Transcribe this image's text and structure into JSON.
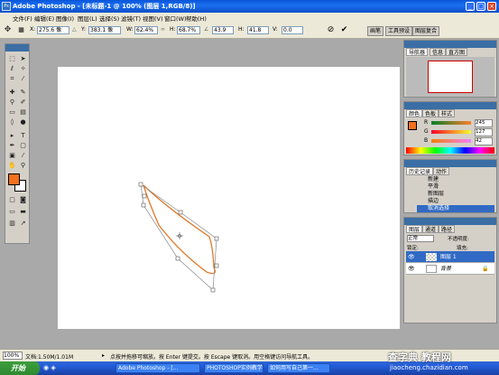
{
  "window": {
    "title": "Adobe Photoshop - [未标题-1 @ 100% (图层 1,RGB/8)]",
    "logo": "Ps",
    "controls": [
      "_",
      "□",
      "×"
    ]
  },
  "menu": {
    "items": [
      "文件(F)",
      "编辑(E)",
      "图像(I)",
      "图层(L)",
      "选择(S)",
      "滤镜(T)",
      "视图(V)",
      "窗口(W)",
      "帮助(H)"
    ]
  },
  "options": {
    "x_label": "X:",
    "x_value": "275.6 像",
    "y_label": "Y:",
    "y_value": "383.1 像",
    "w_label": "W:",
    "w_value": "62.4%",
    "h_label": "H:",
    "h_value": "68.7%",
    "angle_value": "43.9",
    "hskew_label": "H:",
    "hskew_value": "41.8",
    "vskew_label": "V:",
    "vskew_value": "0.0",
    "cancel_icon": "cancel-icon",
    "commit_icon": "commit-icon"
  },
  "dock": {
    "tabs": [
      "画笔",
      "工具预设",
      "图层复合"
    ]
  },
  "navigator": {
    "tabs": [
      "导航器",
      "信息",
      "直方图"
    ]
  },
  "color": {
    "tabs": [
      "颜色",
      "色板",
      "样式"
    ],
    "channels": [
      {
        "label": "R",
        "value": "245"
      },
      {
        "label": "G",
        "value": "127"
      },
      {
        "label": "B",
        "value": "42"
      }
    ],
    "foreground": "#f5701e",
    "background": "#ffffff"
  },
  "history": {
    "tabs": [
      "历史记录",
      "动作"
    ],
    "items": [
      "新建",
      "平滑",
      "新图层",
      "描边",
      "取消选择"
    ],
    "selected_index": 4
  },
  "layers": {
    "tabs": [
      "图层",
      "通道",
      "路径"
    ],
    "blend_mode": "正常",
    "opacity_label": "不透明度:",
    "lock_label": "锁定:",
    "fill_label": "填充:",
    "rows": [
      {
        "name": "图层 1",
        "selected": true
      },
      {
        "name": "背景",
        "selected": false
      }
    ]
  },
  "status": {
    "zoom": "100%",
    "doc_info": "文档:1.50M/1.01M",
    "hint": "点按并拖移可缩放。按 Enter 键提交。按 Escape 键取消。用空格键访问导航工具。"
  },
  "taskbar": {
    "start": "开始",
    "tasks": [
      "Adobe Photoshop - [...",
      "PHOTOSHOP实例教学",
      "如何用写自己第一..."
    ],
    "watermark": "查字典 教程网",
    "watermark_url": "jiaocheng.chazidian.com"
  },
  "colors": {
    "accent_stroke": "#e07a2a",
    "path_line": "#888888",
    "selection_blue": "#316ac5"
  }
}
